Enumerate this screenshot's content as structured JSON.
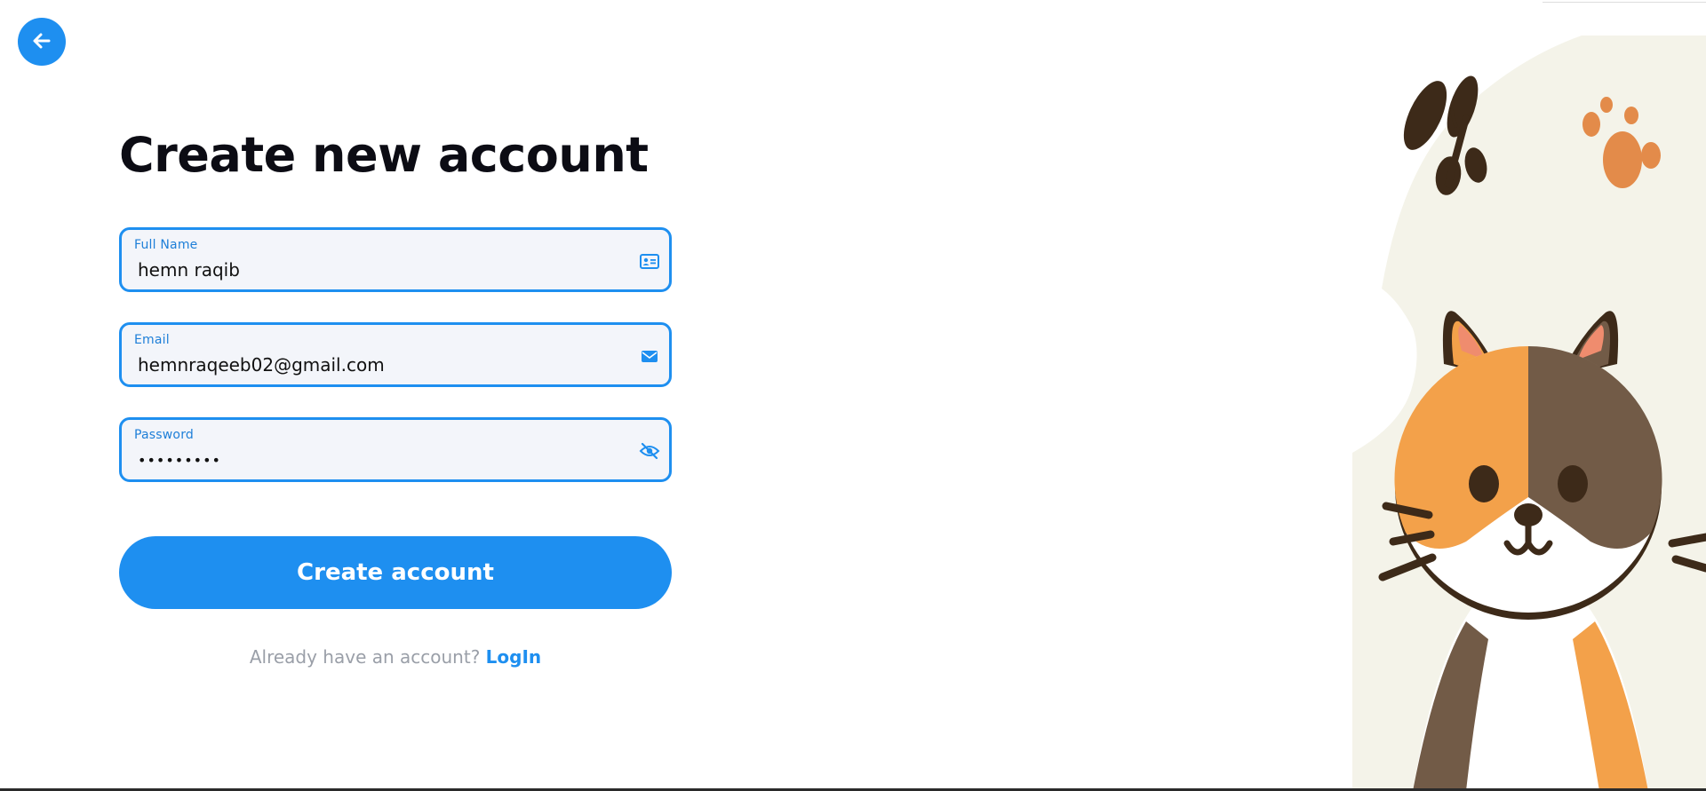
{
  "page": {
    "title": "Create new account",
    "back_icon": "arrow-left-icon"
  },
  "form": {
    "full_name": {
      "label": "Full Name",
      "value": "hemn raqib",
      "icon": "id-card-icon"
    },
    "email": {
      "label": "Email",
      "value": "hemnraqeeb02@gmail.com",
      "icon": "envelope-icon"
    },
    "password": {
      "label": "Password",
      "value": "hemn12345",
      "icon": "eye-slash-icon"
    },
    "submit_label": "Create account"
  },
  "footer": {
    "prompt": "Already have an account?",
    "link_label": "LogIn"
  },
  "illustration": {
    "subject": "cat-illustration",
    "decor": [
      "butterfly-icon",
      "paw-print-icon"
    ]
  },
  "colors": {
    "accent": "#1e8ff0",
    "title": "#0c0c14",
    "field_bg": "#f3f5fa",
    "muted_text": "#9a9fa8"
  }
}
